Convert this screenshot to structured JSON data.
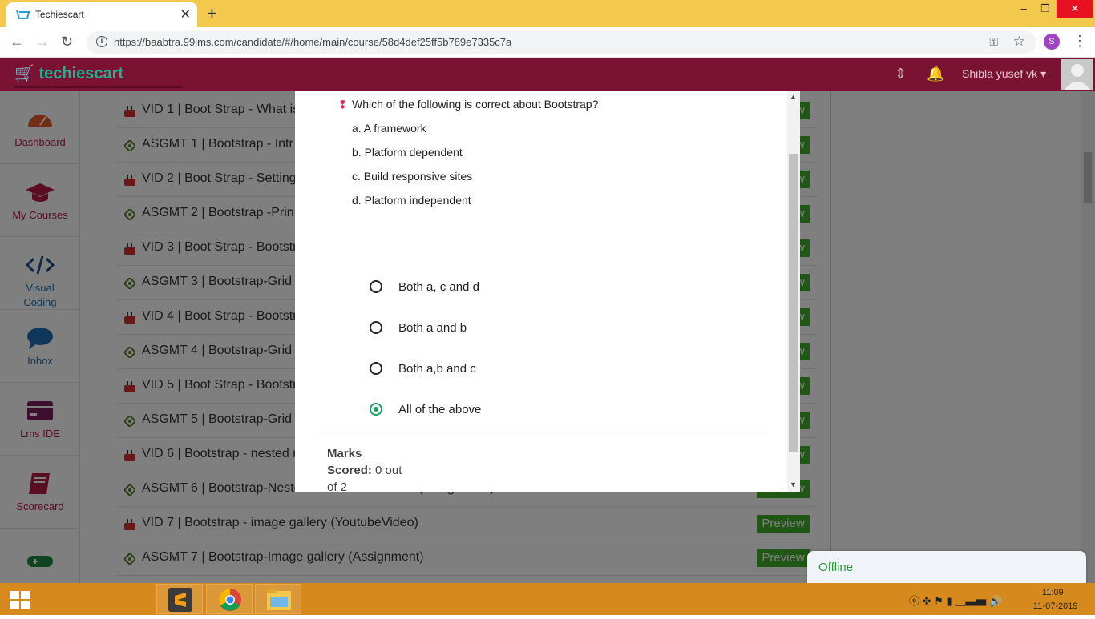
{
  "browser": {
    "tab_title": "Techiescart",
    "url": "https://baabtra.99lms.com/candidate/#/home/main/course/58d4def25ff5b789e7335c7a",
    "profile_initial": "S"
  },
  "header": {
    "logo": "techiescart",
    "user_name": "Shibla yusef vk"
  },
  "sidebar": {
    "items": [
      {
        "label": "Dashboard",
        "icon": "dashboard-icon"
      },
      {
        "label": "My Courses",
        "icon": "graduation-cap-icon"
      },
      {
        "label": "Visual",
        "label2": "Coding",
        "icon": "code-icon"
      },
      {
        "label": "Inbox",
        "icon": "chat-bubble-icon"
      },
      {
        "label": "Lms IDE",
        "icon": "ide-icon"
      },
      {
        "label": "Scorecard",
        "icon": "book-icon"
      },
      {
        "label": "",
        "icon": "gamepad-icon"
      }
    ]
  },
  "lessons": {
    "preview_label": "Preview",
    "items": [
      {
        "text": "VID 1 | Boot Strap - What is",
        "type": "video"
      },
      {
        "text": "ASGMT 1 | Bootstrap - Intr",
        "type": "assignment"
      },
      {
        "text": "VID 2 | Boot Strap - Setting",
        "type": "video"
      },
      {
        "text": "ASGMT 2 | Bootstrap -Prin",
        "type": "assignment"
      },
      {
        "text": "VID 3 | Boot Strap - Bootstr",
        "type": "video"
      },
      {
        "text": "ASGMT 3 | Bootstrap-Grid",
        "type": "assignment"
      },
      {
        "text": "VID 4 | Boot Strap - Bootstr",
        "type": "video"
      },
      {
        "text": "ASGMT 4 | Bootstrap-Grid",
        "type": "assignment"
      },
      {
        "text": "VID 5 | Boot Strap - Bootstr",
        "type": "video"
      },
      {
        "text": "ASGMT 5 | Bootstrap-Grid",
        "type": "assignment"
      },
      {
        "text": "VID 6 | Bootstrap - nested r",
        "type": "video"
      },
      {
        "text": "ASGMT 6 | Bootstrap-Nested rows and columns  (Assignment)",
        "type": "assignment"
      },
      {
        "text": "VID 7 | Bootstrap - image gallery  (YoutubeVideo)",
        "type": "video"
      },
      {
        "text": "ASGMT 7 | Bootstrap-Image gallery  (Assignment)",
        "type": "assignment"
      }
    ]
  },
  "modal": {
    "question": "Which of the following is correct about Bootstrap?",
    "statements": [
      "a. A framework",
      "b. Platform dependent",
      "c. Build responsive sites",
      "d. Platform independent"
    ],
    "choices": [
      {
        "label": "Both a, c and d",
        "selected": false
      },
      {
        "label": "Both a and b",
        "selected": false
      },
      {
        "label": "Both a,b and c",
        "selected": false
      },
      {
        "label": "All of the above",
        "selected": true
      }
    ],
    "marks_title": "Marks",
    "scored_label": "Scored:",
    "scored_value": "0 out",
    "scored_of": "of 2"
  },
  "offline_status": "Offline",
  "taskbar": {
    "time": "11:09",
    "date": "11-07-2019"
  },
  "colors": {
    "header": "#7a1233",
    "logo": "#1db38f",
    "preview": "#3fae2a",
    "taskbar": "#d68a1e",
    "selected_radio": "#1a9f5c"
  }
}
